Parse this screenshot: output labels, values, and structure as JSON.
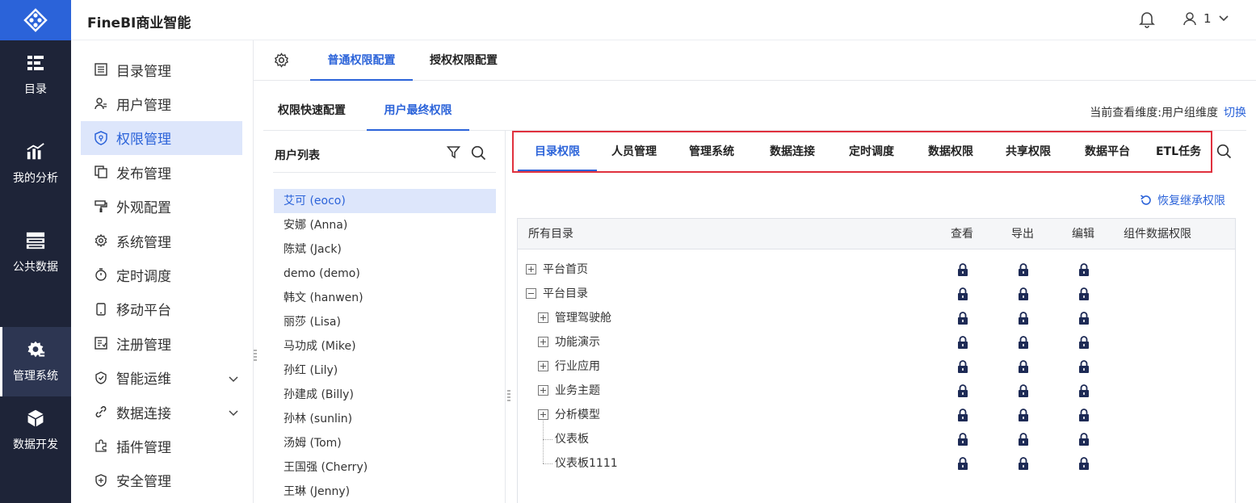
{
  "app": {
    "title": "FineBI商业智能",
    "user_name": "1"
  },
  "rail": {
    "items": [
      {
        "label": "目录",
        "icon": "catalog-icon"
      },
      {
        "label": "我的分析",
        "icon": "analysis-icon"
      },
      {
        "label": "公共数据",
        "icon": "database-icon"
      },
      {
        "label": "管理系统",
        "icon": "admin-gear-icon",
        "active": true
      },
      {
        "label": "数据开发",
        "icon": "cube-icon"
      }
    ]
  },
  "submenu": {
    "items": [
      {
        "label": "目录管理",
        "icon": "list-icon"
      },
      {
        "label": "用户管理",
        "icon": "user-icon"
      },
      {
        "label": "权限管理",
        "icon": "shield-icon",
        "active": true
      },
      {
        "label": "发布管理",
        "icon": "copy-icon"
      },
      {
        "label": "外观配置",
        "icon": "paint-icon"
      },
      {
        "label": "系统管理",
        "icon": "gear-icon"
      },
      {
        "label": "定时调度",
        "icon": "timer-icon"
      },
      {
        "label": "移动平台",
        "icon": "mobile-icon"
      },
      {
        "label": "注册管理",
        "icon": "register-icon"
      },
      {
        "label": "智能运维",
        "icon": "ops-icon",
        "expandable": true
      },
      {
        "label": "数据连接",
        "icon": "link-icon",
        "expandable": true
      },
      {
        "label": "插件管理",
        "icon": "plugin-icon"
      },
      {
        "label": "安全管理",
        "icon": "security-icon"
      }
    ]
  },
  "top_tabs": [
    {
      "label": "普通权限配置",
      "active": true
    },
    {
      "label": "授权权限配置"
    }
  ],
  "sub_tabs": [
    {
      "label": "权限快速配置"
    },
    {
      "label": "用户最终权限",
      "active": true
    }
  ],
  "dimension": {
    "text": "当前查看维度:用户组维度",
    "switch_label": "切换"
  },
  "user_list": {
    "title": "用户列表",
    "users": [
      "艾可 (eoco)",
      "安娜 (Anna)",
      "陈斌 (Jack)",
      "demo (demo)",
      "韩文 (hanwen)",
      "丽莎 (Lisa)",
      "马功成 (Mike)",
      "孙红 (Lily)",
      "孙建成 (Billy)",
      "孙林 (sunlin)",
      "汤姆 (Tom)",
      "王国强 (Cherry)",
      "王琳 (Jenny)"
    ],
    "selected_index": 0
  },
  "perm_tabs": [
    "目录权限",
    "人员管理",
    "管理系统",
    "数据连接",
    "定时调度",
    "数据权限",
    "共享权限",
    "数据平台",
    "ETL任务"
  ],
  "restore_label": "恢复继承权限",
  "table": {
    "headers": {
      "name": "所有目录",
      "view": "查看",
      "export": "导出",
      "edit": "编辑",
      "component": "组件数据权限"
    },
    "rows": [
      {
        "name": "平台首页",
        "level": 0,
        "expander": "plus"
      },
      {
        "name": "平台目录",
        "level": 0,
        "expander": "minus"
      },
      {
        "name": "管理驾驶舱",
        "level": 1,
        "expander": "plus"
      },
      {
        "name": "功能演示",
        "level": 1,
        "expander": "plus"
      },
      {
        "name": "行业应用",
        "level": 1,
        "expander": "plus"
      },
      {
        "name": "业务主题",
        "level": 1,
        "expander": "plus"
      },
      {
        "name": "分析模型",
        "level": 1,
        "expander": "plus"
      },
      {
        "name": "仪表板",
        "level": 1,
        "expander": "none"
      },
      {
        "name": "仪表板1111",
        "level": 1,
        "expander": "none"
      }
    ],
    "permission_state": "locked"
  },
  "colors": {
    "accent": "#2b63d9",
    "rail_bg": "#1e2438",
    "highlight_border": "#e0313e",
    "active_bg": "#dde6fb"
  }
}
